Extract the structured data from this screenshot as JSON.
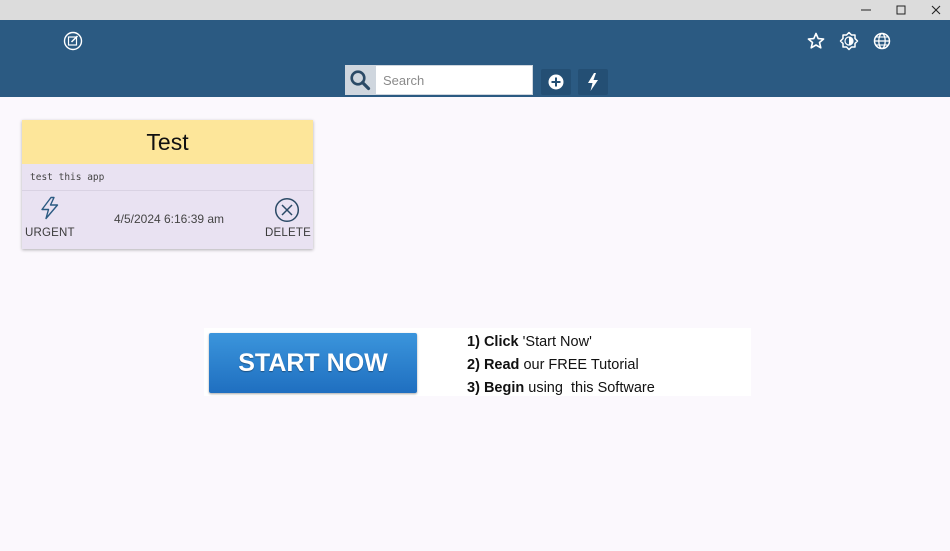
{
  "window": {
    "minimize_glyph": "—",
    "maximize_glyph": "□",
    "close_glyph": "✕"
  },
  "appbar": {
    "background": "#2b5a82",
    "icons": [
      "edit-note-icon",
      "star-icon",
      "brightness-icon",
      "globe-icon"
    ]
  },
  "search": {
    "placeholder": "Search",
    "value": ""
  },
  "toolbar": {
    "add_icon": "plus-circle-icon",
    "urgent_filter_icon": "lightning-icon"
  },
  "note": {
    "title": "Test",
    "body": "test this app",
    "urgent_label": "URGENT",
    "date": "4/5/2024 6:16:39 am",
    "delete_label": "DELETE",
    "header_color": "#fde69a",
    "card_color": "#e9e2f2"
  },
  "banner": {
    "button_label": "START NOW",
    "steps": [
      {
        "num": "1)",
        "verb": "Click",
        "rest": "'Start Now'"
      },
      {
        "num": "2)",
        "verb": "Read",
        "rest": "our FREE Tutorial"
      },
      {
        "num": "3)",
        "verb": "Begin",
        "rest": "using  this Software"
      }
    ]
  }
}
